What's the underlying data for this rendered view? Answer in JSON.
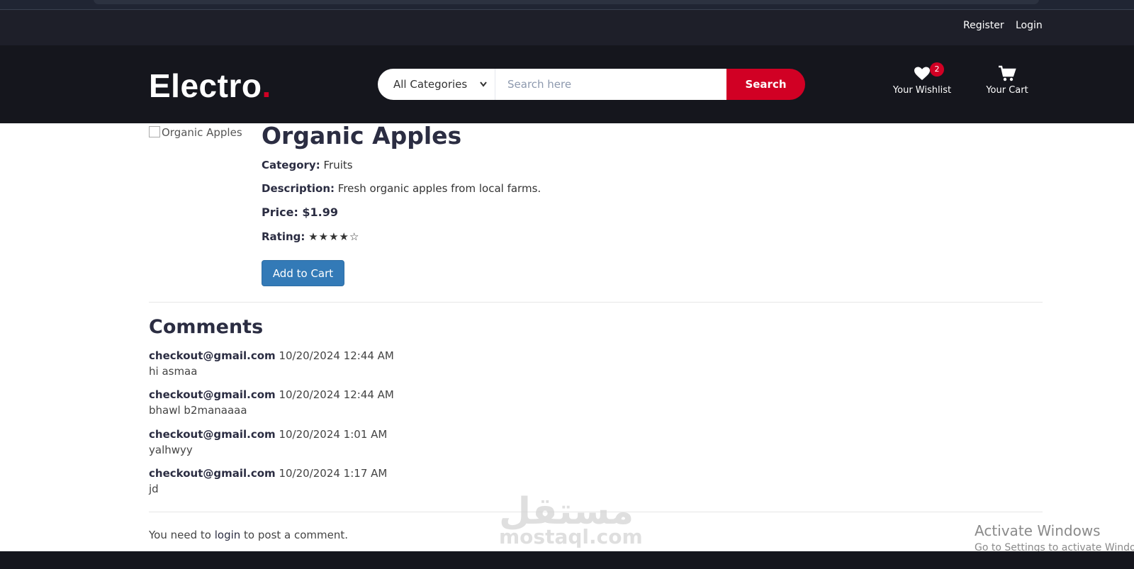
{
  "top_header": {
    "links": [
      "Register",
      "Login"
    ]
  },
  "header": {
    "logo_text": "Electro",
    "logo_dot": ".",
    "search": {
      "category_selected": "All Categories",
      "placeholder": "Search here",
      "button_label": "Search"
    },
    "wishlist": {
      "label": "Your Wishlist",
      "count": "2"
    },
    "cart": {
      "label": "Your Cart"
    }
  },
  "product": {
    "image_alt": "Organic Apples",
    "title": "Organic Apples",
    "category_label": "Category:",
    "category_value": "Fruits",
    "description_label": "Description:",
    "description_value": "Fresh organic apples from local farms.",
    "price_label": "Price: $1.99",
    "rating_label": "Rating:",
    "rating_stars": "★★★★☆",
    "add_to_cart_label": "Add to Cart"
  },
  "comments": {
    "title": "Comments",
    "items": [
      {
        "author": "checkout@gmail.com",
        "date": "10/20/2024 12:44 AM",
        "text": "hi asmaa"
      },
      {
        "author": "checkout@gmail.com",
        "date": "10/20/2024 12:44 AM",
        "text": "bhawl b2manaaaa"
      },
      {
        "author": "checkout@gmail.com",
        "date": "10/20/2024 1:01 AM",
        "text": "yalhwyy"
      },
      {
        "author": "checkout@gmail.com",
        "date": "10/20/2024 1:17 AM",
        "text": "jd"
      }
    ],
    "login_prefix": "You need to",
    "login_link": "login",
    "login_suffix": "to post a comment."
  },
  "watermark": {
    "arabic": "مستقل",
    "latin": "mostaql.com"
  },
  "os_overlay": {
    "title": "Activate Windows",
    "subtitle": "Go to Settings to activate Windows."
  },
  "colors": {
    "brand_red": "#d10024",
    "header_dark": "#15161d",
    "top_header": "#1e1f29",
    "button_blue": "#337ab7",
    "heading": "#2b2d42"
  }
}
